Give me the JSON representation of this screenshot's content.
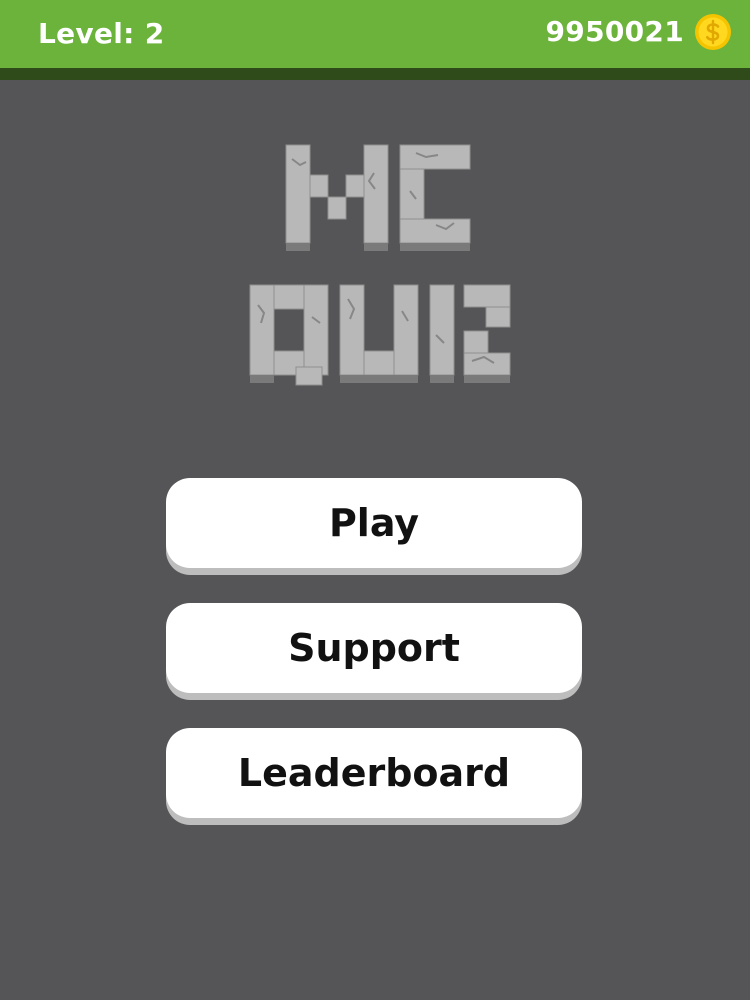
{
  "header": {
    "level_label": "Level: 2",
    "coins": "9950021",
    "coin_icon": "dollar-coin-icon",
    "bar_color": "#6cb33c",
    "bar_shadow_color": "#2f4b1a"
  },
  "logo": {
    "line1": "MC",
    "line2": "QUIZ",
    "stone_color": "#b8b8b8"
  },
  "menu": {
    "play_label": "Play",
    "support_label": "Support",
    "leaderboard_label": "Leaderboard"
  },
  "background_color": "#555457"
}
